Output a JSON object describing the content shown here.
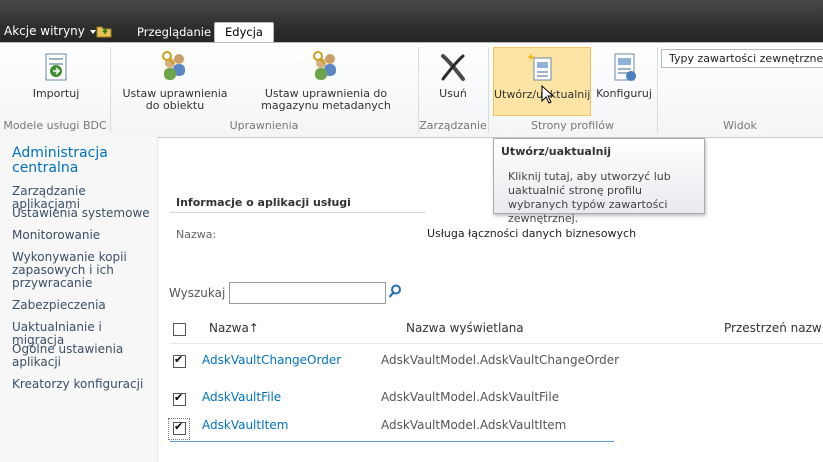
{
  "topbar": {
    "site_actions": "Akcje witryny",
    "tabs": [
      {
        "label": "Przeglądanie",
        "active": false
      },
      {
        "label": "Edycja",
        "active": true
      }
    ]
  },
  "ribbon": {
    "groups": [
      {
        "label": "Modele usługi BDC",
        "buttons": [
          {
            "label": "Importuj",
            "icon": "import-icon"
          }
        ]
      },
      {
        "label": "Uprawnienia",
        "buttons": [
          {
            "label": "Ustaw uprawnienia do obiektu",
            "icon": "set-object-permissions-icon"
          },
          {
            "label": "Ustaw uprawnienia do magazynu metadanych",
            "icon": "set-metadata-store-permissions-icon"
          }
        ]
      },
      {
        "label": "Zarządzanie",
        "buttons": [
          {
            "label": "Usuń",
            "icon": "delete-icon"
          }
        ]
      },
      {
        "label": "Strony profilów",
        "buttons": [
          {
            "label": "Utwórz/uaktualnij",
            "icon": "create-upgrade-icon",
            "hovered": true
          },
          {
            "label": "Konfiguruj",
            "icon": "configure-icon"
          }
        ]
      },
      {
        "label": "Widok",
        "select_value": "Typy zawartości zewnętrznej"
      }
    ]
  },
  "tooltip": {
    "title": "Utwórz/uaktualnij",
    "body": "Kliknij tutaj, aby utworzyć lub uaktualnić stronę profilu wybranych typów zawartości zewnętrznej."
  },
  "leftnav": {
    "title": "Administracja centralna",
    "items": [
      "Zarządzanie aplikacjami",
      "Ustawienia systemowe",
      "Monitorowanie",
      "Wykonywanie kopii zapasowych i ich przywracanie",
      "Zabezpieczenia",
      "Uaktualnianie i migracja",
      "Ogólne ustawienia aplikacji",
      "Kreatorzy konfiguracji"
    ]
  },
  "main": {
    "info_title": "Informacje o aplikacji usługi",
    "name_label": "Nazwa:",
    "name_value": "Usługa łączności danych biznesowych",
    "search_label": "Wyszukaj",
    "search_value": "",
    "columns": [
      "Nazwa",
      "Nazwa wyświetlana",
      "Przestrzeń nazw"
    ],
    "sort_indicator": "↑",
    "rows": [
      {
        "name": "AdskVaultChangeOrder",
        "display": "AdskVaultModel.AdskVaultChangeOrder",
        "checked": true
      },
      {
        "name": "AdskVaultFile",
        "display": "AdskVaultModel.AdskVaultFile",
        "checked": true
      },
      {
        "name": "AdskVaultItem",
        "display": "AdskVaultModel.AdskVaultItem",
        "checked": true
      }
    ]
  }
}
